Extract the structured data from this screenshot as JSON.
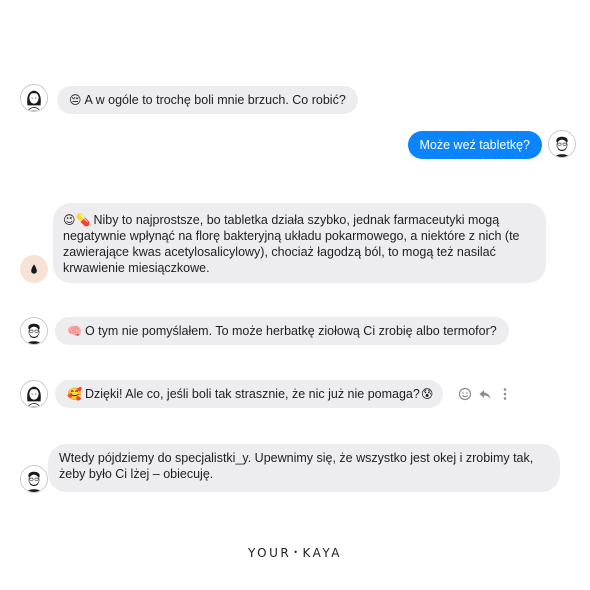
{
  "messages": [
    {
      "sender": "girl",
      "emoji": "😔",
      "text": "A w ogóle to trochę boli mnie brzuch. Co robić?"
    },
    {
      "sender": "guy",
      "text": "Może weź tabletkę?"
    },
    {
      "sender": "kaya",
      "emoji": "😉💊",
      "text": "Niby to najprostsze, bo tabletka działa szybko, jednak farmaceutyki mogą negatywnie wpłynąć na florę bakteryjną układu pokarmowego, a niektóre z nich (te zawierające kwas acetylosalicylowy), chociaż łagodzą ból, to mogą też nasilać krwawienie miesiączkowe."
    },
    {
      "sender": "guy",
      "emoji": "🧠",
      "text": "O tym nie pomyślałem. To może herbatkę ziołową Ci zrobię albo termofor?"
    },
    {
      "sender": "girl",
      "emoji": "🥰",
      "text": "Dzięki! Ale co, jeśli boli tak strasznie, że nic już nie pomaga?",
      "trailing_emoji": "😰",
      "actions": [
        "smiley-icon",
        "reply-icon",
        "more-icon"
      ]
    },
    {
      "sender": "guy",
      "text": "Wtedy pójdziemy do specjalistki_y. Upewnimy się, że wszystko jest okej i zrobimy tak, żeby było Ci lżej – obiecuję."
    }
  ],
  "brand": {
    "left": "YOUR",
    "separator": "•",
    "right": "KAYA"
  },
  "colors": {
    "received_bubble": "#ededf0",
    "sent_bubble": "#0a84ff",
    "sent_text": "#ffffff",
    "drop_avatar_bg": "#f6e3d6"
  }
}
